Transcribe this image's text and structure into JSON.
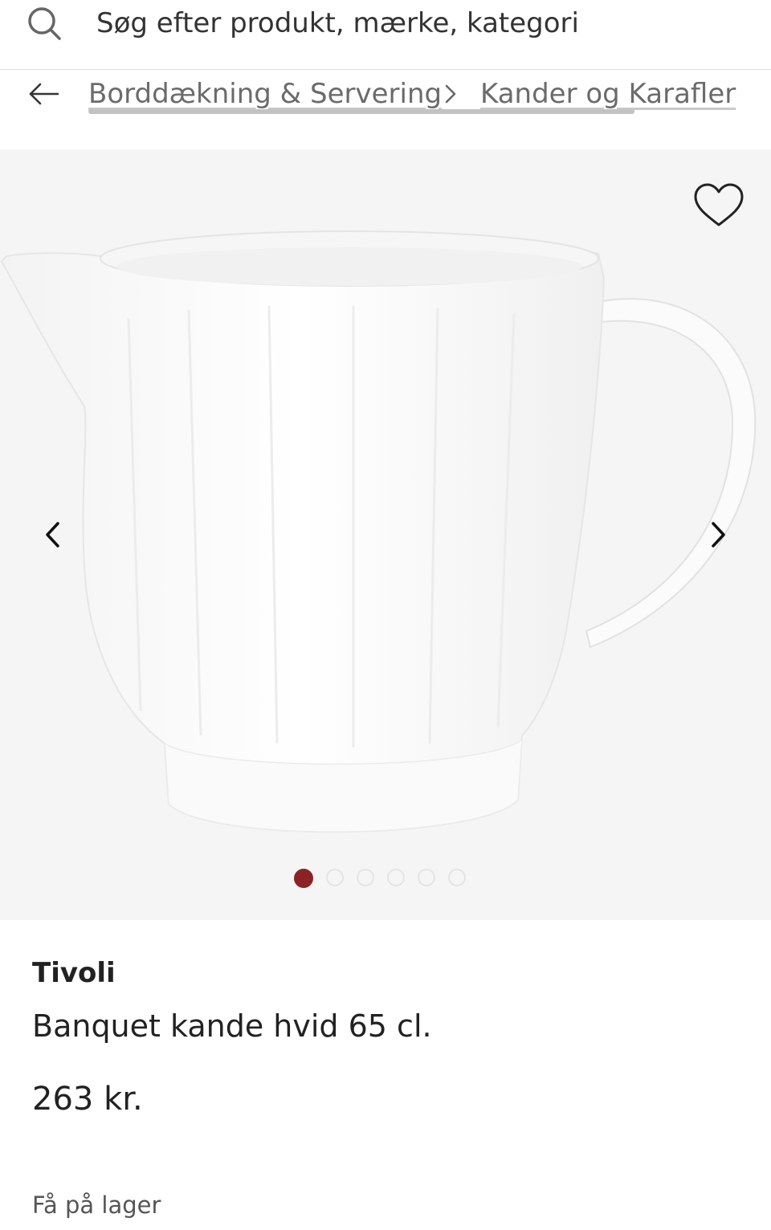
{
  "search": {
    "placeholder": "Søg efter produkt, mærke, kategori",
    "icon": "search-icon"
  },
  "breadcrumb": {
    "items": [
      {
        "label": "Borddækning & Servering"
      },
      {
        "label": "Kander og Karafler"
      }
    ],
    "back_icon": "arrow-left-icon",
    "separator_icon": "chevron-right-icon"
  },
  "gallery": {
    "image_alt": "white porcelain pitcher",
    "favorite_icon": "heart-outline-icon",
    "prev_icon": "chevron-left-icon",
    "next_icon": "chevron-right-icon",
    "dots_total": 6,
    "active_dot": 1,
    "active_color": "#8b2326"
  },
  "product": {
    "brand": "Tivoli",
    "title": "Banquet kande hvid 65 cl.",
    "price": "263 kr.",
    "stock": "Få på lager"
  }
}
